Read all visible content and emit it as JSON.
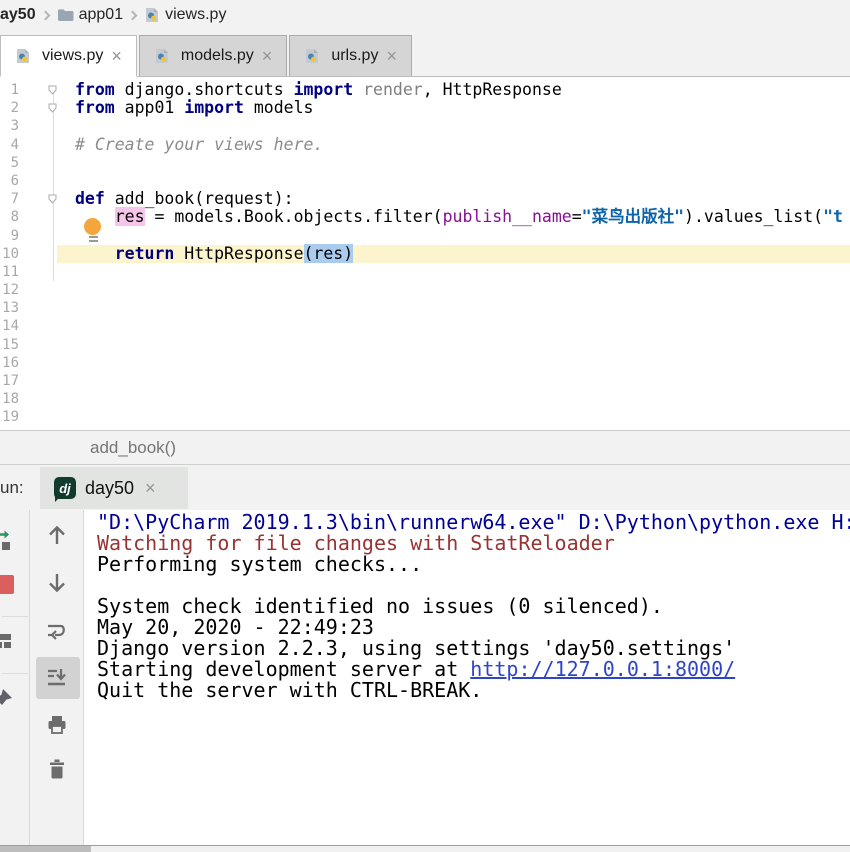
{
  "breadcrumb": {
    "items": [
      {
        "label": "ay50",
        "icon": null
      },
      {
        "label": "app01",
        "icon": "folder-icon"
      },
      {
        "label": "views.py",
        "icon": "python-file-icon"
      }
    ]
  },
  "tabs": [
    {
      "label": "views.py",
      "icon": "python-file-icon",
      "active": true
    },
    {
      "label": "models.py",
      "icon": "python-file-icon",
      "active": false
    },
    {
      "label": "urls.py",
      "icon": "python-file-icon",
      "active": false
    }
  ],
  "editor": {
    "current_line": "10",
    "breadcrumb": "add_book()",
    "lines": [
      {
        "n": "1",
        "tokens": [
          [
            "kw",
            "from"
          ],
          [
            "pl",
            " django.shortcuts "
          ],
          [
            "kw",
            "import"
          ],
          [
            "pl",
            " "
          ],
          [
            "gray",
            "render"
          ],
          [
            "pl",
            ", HttpResponse"
          ]
        ]
      },
      {
        "n": "2",
        "tokens": [
          [
            "kw",
            "from"
          ],
          [
            "pl",
            " app01 "
          ],
          [
            "kw",
            "import"
          ],
          [
            "pl",
            " models"
          ]
        ]
      },
      {
        "n": "3",
        "tokens": []
      },
      {
        "n": "4",
        "tokens": [
          [
            "cmt",
            "# Create your views here."
          ]
        ]
      },
      {
        "n": "5",
        "tokens": []
      },
      {
        "n": "6",
        "tokens": []
      },
      {
        "n": "7",
        "tokens": [
          [
            "kw",
            "def"
          ],
          [
            "pl",
            " add_book(request):"
          ]
        ]
      },
      {
        "n": "8",
        "tokens": [
          [
            "pl",
            "    "
          ],
          [
            "hlW",
            "res"
          ],
          [
            "pl",
            " = models.Book.objects.filter("
          ],
          [
            "param",
            "publish__name"
          ],
          [
            "pl",
            "="
          ],
          [
            "str",
            "\"菜鸟出版社\""
          ],
          [
            "pl",
            ").values_list("
          ],
          [
            "str",
            "\"t"
          ]
        ]
      },
      {
        "n": "9",
        "tokens": []
      },
      {
        "n": "10",
        "tokens": [
          [
            "pl",
            "    "
          ],
          [
            "kw",
            "return"
          ],
          [
            "pl",
            " HttpResponse"
          ],
          [
            "hlB",
            "(res)"
          ]
        ]
      },
      {
        "n": "11",
        "tokens": []
      },
      {
        "n": "12",
        "tokens": []
      },
      {
        "n": "13",
        "tokens": []
      },
      {
        "n": "14",
        "tokens": []
      },
      {
        "n": "15",
        "tokens": []
      },
      {
        "n": "16",
        "tokens": []
      },
      {
        "n": "17",
        "tokens": []
      },
      {
        "n": "18",
        "tokens": []
      },
      {
        "n": "19",
        "tokens": []
      }
    ]
  },
  "run": {
    "label": "un:",
    "tab": "day50",
    "tab_icon": "django-icon",
    "left_toolbar_icons": [
      "rerun-icon",
      "stop-icon",
      "restore-layout-icon",
      "pin-icon"
    ],
    "console_toolbar_icons": [
      "up-arrow-icon",
      "down-arrow-icon",
      "soft-wrap-icon",
      "scroll-to-end-icon",
      "print-icon",
      "clear-all-icon"
    ]
  },
  "console": {
    "lines": [
      {
        "c": "navy",
        "t": "\"D:\\PyCharm 2019.1.3\\bin\\runnerw64.exe\" D:\\Python\\python.exe H:"
      },
      {
        "c": "red",
        "t": "Watching for file changes with StatReloader"
      },
      {
        "c": "pl",
        "t": "Performing system checks..."
      },
      {
        "c": "pl",
        "t": ""
      },
      {
        "c": "pl",
        "t": "System check identified no issues (0 silenced)."
      },
      {
        "c": "pl",
        "t": "May 20, 2020 - 22:49:23"
      },
      {
        "c": "pl",
        "t": "Django version 2.2.3, using settings 'day50.settings'"
      },
      {
        "c": "pl",
        "t": "Starting development server at ",
        "link": "http://127.0.0.1:8000/"
      },
      {
        "c": "pl",
        "t": "Quit the server with CTRL-BREAK."
      }
    ]
  },
  "colors": {
    "panel_bg": "#F2F2F2",
    "keyword": "#000080",
    "string": "#0E64A8",
    "comment": "#8C8C8C",
    "param": "#871094",
    "caret_row": "#FCF4CC",
    "occurrence_write_bg": "#F6C6EA",
    "occurrence_read_bg": "#A9CBEE",
    "stdout_navy": "#000096",
    "stderr_red": "#993333",
    "link": "#2E45C8",
    "rerun_green": "#368F63",
    "stop_red": "#DB5F5F",
    "django_green": "#113B2C"
  }
}
